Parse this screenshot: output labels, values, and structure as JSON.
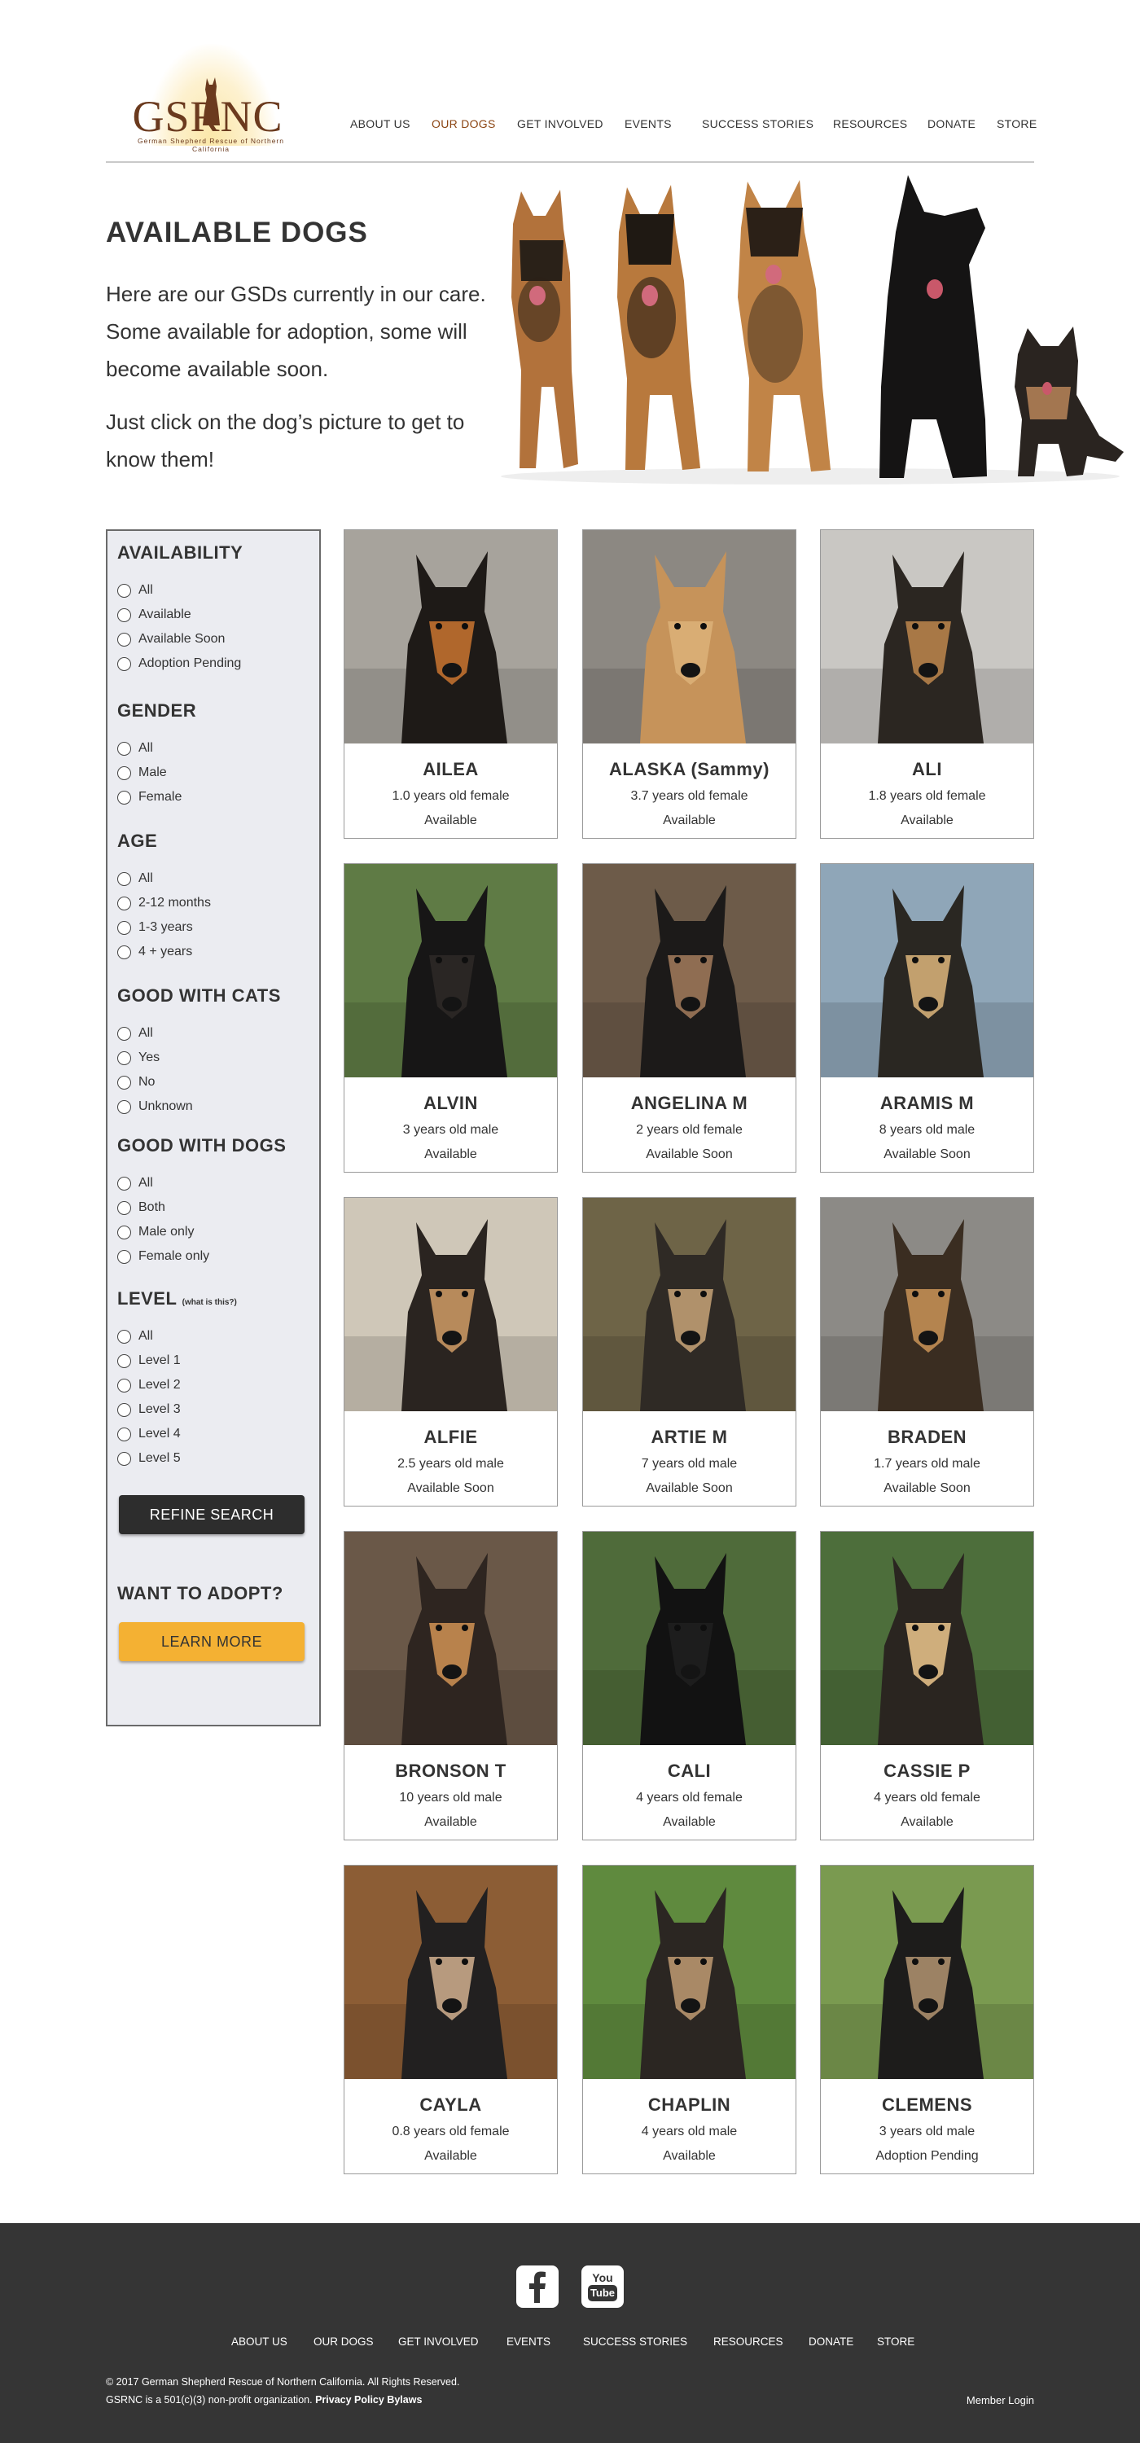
{
  "logo": {
    "text": "GSRNC",
    "tagline": "German Shepherd Rescue of Northern California"
  },
  "nav": [
    "ABOUT US",
    "OUR DOGS",
    "GET INVOLVED",
    "EVENTS",
    "SUCCESS STORIES",
    "RESOURCES",
    "DONATE",
    "STORE"
  ],
  "hero": {
    "title": "AVAILABLE DOGS",
    "para1": "Here are our GSDs currently in our care. Some available for adoption, some will become available soon.",
    "para2": "Just click on the dog’s picture to get to know them!"
  },
  "filters": {
    "availability": {
      "heading": "AVAILABILITY",
      "options": [
        "All",
        "Available",
        "Available Soon",
        "Adoption Pending"
      ]
    },
    "gender": {
      "heading": "GENDER",
      "options": [
        "All",
        "Male",
        "Female"
      ]
    },
    "age": {
      "heading": "AGE",
      "options": [
        "All",
        "2-12 months",
        "1-3 years",
        "4 + years"
      ]
    },
    "cats": {
      "heading": "GOOD WITH CATS",
      "options": [
        "All",
        "Yes",
        "No",
        "Unknown"
      ]
    },
    "dogs": {
      "heading": "GOOD WITH DOGS",
      "options": [
        "All",
        "Both",
        "Male only",
        "Female only"
      ]
    },
    "level": {
      "heading": "LEVEL",
      "note": "(what is this?)",
      "options": [
        "All",
        "Level 1",
        "Level 2",
        "Level 3",
        "Level 4",
        "Level 5"
      ]
    },
    "refine_label": "REFINE SEARCH",
    "adopt_heading": "WANT TO ADOPT?",
    "learn_label": "LEARN MORE"
  },
  "dogs": [
    {
      "name": "AILEA",
      "age": "1.0 years old female",
      "status": "Available",
      "coat": "#1e1a17",
      "tan": "#b0672c",
      "bg": "#a7a39c"
    },
    {
      "name": "ALASKA (Sammy)",
      "age": "3.7 years old female",
      "status": "Available",
      "coat": "#c6935a",
      "tan": "#d9ad74",
      "bg": "#8c8882"
    },
    {
      "name": "ALI",
      "age": "1.8 years old female",
      "status": "Available",
      "coat": "#2b2621",
      "tan": "#a87846",
      "bg": "#c9c7c3"
    },
    {
      "name": "ALVIN",
      "age": "3 years old male",
      "status": "Available",
      "coat": "#171616",
      "tan": "#2a2624",
      "bg": "#5f7b45"
    },
    {
      "name": "ANGELINA M",
      "age": "2 years old female",
      "status": "Available Soon",
      "coat": "#1c1a19",
      "tan": "#8f6d52",
      "bg": "#6d5b49"
    },
    {
      "name": "ARAMIS M",
      "age": "8 years old male",
      "status": "Available Soon",
      "coat": "#2a2722",
      "tan": "#c2a06e",
      "bg": "#8fa6b8"
    },
    {
      "name": "ALFIE",
      "age": "2.5 years old male",
      "status": "Available Soon",
      "coat": "#2a2420",
      "tan": "#b78a5b",
      "bg": "#cfc7b8"
    },
    {
      "name": "ARTIE M",
      "age": "7 years old male",
      "status": "Available Soon",
      "coat": "#2f2a25",
      "tan": "#b0916b",
      "bg": "#6e6447"
    },
    {
      "name": "BRADEN",
      "age": "1.7 years old male",
      "status": "Available Soon",
      "coat": "#3a2d21",
      "tan": "#b4844f",
      "bg": "#8c8a86"
    },
    {
      "name": "BRONSON T",
      "age": "10 years old male",
      "status": "Available",
      "coat": "#2e2520",
      "tan": "#b8824c",
      "bg": "#6a5848"
    },
    {
      "name": "CALI",
      "age": "4 years old female",
      "status": "Available",
      "coat": "#121212",
      "tan": "#1d1d1d",
      "bg": "#4f6b3a"
    },
    {
      "name": "CASSIE P",
      "age": "4 years old female",
      "status": "Available",
      "coat": "#2a2520",
      "tan": "#cfae7c",
      "bg": "#4d6e3b"
    },
    {
      "name": "CAYLA",
      "age": "0.8 years old female",
      "status": "Available",
      "coat": "#222020",
      "tan": "#b79a7e",
      "bg": "#8c5d35"
    },
    {
      "name": "CHAPLIN",
      "age": "4 years old male",
      "status": "Available",
      "coat": "#2b2622",
      "tan": "#a98966",
      "bg": "#5f8a3e"
    },
    {
      "name": "CLEMENS",
      "age": "3 years old male",
      "status": "Adoption Pending",
      "coat": "#1d1c1b",
      "tan": "#9c8264",
      "bg": "#7a9a50"
    }
  ],
  "footer": {
    "nav": [
      "ABOUT US",
      "OUR DOGS",
      "GET INVOLVED",
      "EVENTS",
      "SUCCESS STORIES",
      "RESOURCES",
      "DONATE",
      "STORE"
    ],
    "copyright": "© 2017 German Shepherd Rescue of Northern California. All Rights Reserved.",
    "nonprofit": "GSRNC is a 501(c)(3) non-profit organization.",
    "privacy": "Privacy Policy",
    "bylaws": "Bylaws",
    "member_login": "Member Login",
    "youtube_top": "You",
    "youtube_bottom": "Tube"
  },
  "colors": {
    "accent_brown": "#8b4513",
    "learn_button": "#f4b133",
    "refine_button": "#2d2d2d",
    "footer_bg": "#353535",
    "sidebar_bg": "#ebecf1"
  }
}
